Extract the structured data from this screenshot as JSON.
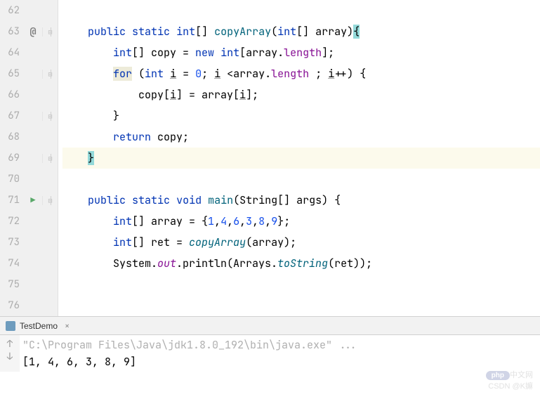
{
  "lines": {
    "62": "",
    "63_pre": "    ",
    "63_kw1": "public",
    "63_sp1": " ",
    "63_kw2": "static",
    "63_sp2": " ",
    "63_kw3": "int",
    "63_txt1": "[] ",
    "63_method": "copyArray",
    "63_txt2": "(",
    "63_kw4": "int",
    "63_txt3": "[] array)",
    "63_brace": "{",
    "64_pre": "        ",
    "64_kw1": "int",
    "64_txt1": "[] copy = ",
    "64_kw2": "new",
    "64_sp": " ",
    "64_kw3": "int",
    "64_txt2": "[array.",
    "64_field": "length",
    "64_txt3": "];",
    "65_pre": "        ",
    "65_for": "for",
    "65_txt1": " (",
    "65_kw1": "int",
    "65_sp": " ",
    "65_var1": "i",
    "65_txt2": " = ",
    "65_num1": "0",
    "65_txt3": "; ",
    "65_var2": "i",
    "65_txt4": " <array.",
    "65_field": "length",
    "65_txt5": " ; ",
    "65_var3": "i",
    "65_txt6": "++) {",
    "66_pre": "            copy[",
    "66_var1": "i",
    "66_txt1": "] = array[",
    "66_var2": "i",
    "66_txt2": "];",
    "67": "        }",
    "68_pre": "        ",
    "68_kw": "return",
    "68_txt": " copy;",
    "69_pre": "    ",
    "69_brace": "}",
    "70": "",
    "71_pre": "    ",
    "71_kw1": "public",
    "71_sp1": " ",
    "71_kw2": "static",
    "71_sp2": " ",
    "71_kw3": "void",
    "71_sp3": " ",
    "71_method": "main",
    "71_txt1": "(String[] args) {",
    "72_pre": "        ",
    "72_kw1": "int",
    "72_txt1": "[] array = {",
    "72_n1": "1",
    "72_c1": ",",
    "72_n2": "4",
    "72_c2": ",",
    "72_n3": "6",
    "72_c3": ",",
    "72_n4": "3",
    "72_c4": ",",
    "72_n5": "8",
    "72_c5": ",",
    "72_n6": "9",
    "72_txt2": "};",
    "73_pre": "        ",
    "73_kw1": "int",
    "73_txt1": "[] ret = ",
    "73_call": "copyArray",
    "73_txt2": "(array);",
    "74_pre": "        System.",
    "74_out": "out",
    "74_txt1": ".println(Arrays.",
    "74_tostr": "toString",
    "74_txt2": "(ret));",
    "75": "",
    "76": ""
  },
  "lineNums": [
    "62",
    "63",
    "64",
    "65",
    "66",
    "67",
    "68",
    "69",
    "70",
    "71",
    "72",
    "73",
    "74",
    "75",
    "76"
  ],
  "gutterIcons": {
    "at": "@",
    "run": "▶"
  },
  "console": {
    "tabName": "TestDemo",
    "closeIcon": "×",
    "cmd": "\"C:\\Program Files\\Java\\jdk1.8.0_192\\bin\\java.exe\" ...",
    "output": "[1, 4, 6, 3, 8, 9]",
    "arrowUp": "↑",
    "arrowDown": "↓"
  },
  "watermark": {
    "logo": "php",
    "text": "中文网",
    "credit": "CSDN @K嫲"
  }
}
